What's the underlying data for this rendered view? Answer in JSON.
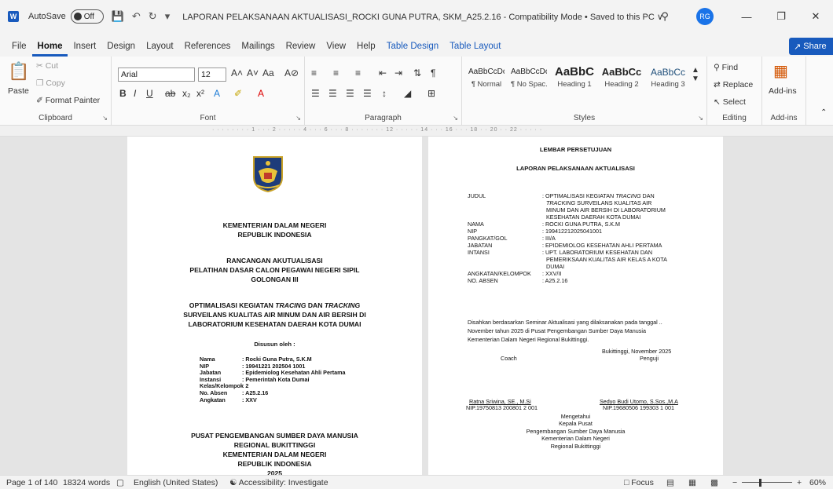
{
  "titlebar": {
    "app_icon": "W",
    "autosave_label": "AutoSave",
    "autosave_state": "Off",
    "document_title": "LAPORAN PELAKSANAAN AKTUALISASI_ROCKI GUNA PUTRA, SKM_A25.2.16  -  Compatibility Mode • Saved to this PC ∨",
    "user_initials": "RG"
  },
  "menu": {
    "items": [
      "File",
      "Home",
      "Insert",
      "Design",
      "Layout",
      "References",
      "Mailings",
      "Review",
      "View",
      "Help",
      "Table Design",
      "Table Layout"
    ],
    "share_label": "Share"
  },
  "ribbon": {
    "clipboard": {
      "paste": "Paste",
      "cut": "Cut",
      "copy": "Copy",
      "format_painter": "Format Painter",
      "label": "Clipboard"
    },
    "font": {
      "font_name": "Arial",
      "font_size": "12",
      "label": "Font"
    },
    "paragraph": {
      "label": "Paragraph"
    },
    "styles": {
      "items": [
        {
          "sample": "AaBbCcDc",
          "name": "¶ Normal"
        },
        {
          "sample": "AaBbCcDc",
          "name": "¶ No Spac..."
        },
        {
          "sample": "AaBbC",
          "name": "Heading 1"
        },
        {
          "sample": "AaBbCc",
          "name": "Heading 2"
        },
        {
          "sample": "AaBbCc",
          "name": "Heading 3"
        }
      ],
      "label": "Styles"
    },
    "editing": {
      "find": "Find",
      "replace": "Replace",
      "select": "Select",
      "label": "Editing"
    },
    "addins": {
      "button": "Add-ins",
      "label": "Add-ins"
    }
  },
  "ruler_text": "· · · · · · · · 1 · · · 2 · · · · · 4 · · · 6 · · · 8 · · · · · · · 12 · · · · · 14 · · · 16 · · · 18 · · 20 · · 22 · · · · ·",
  "page1": {
    "ministry": [
      "KEMENTERIAN DALAM NEGERI",
      "REPUBLIK INDONESIA"
    ],
    "design": [
      "RANCANGAN AKUTUALISASI",
      "PELATIHAN DASAR CALON PEGAWAI NEGERI SIPIL",
      "GOLONGAN III"
    ],
    "topic_parts": [
      "OPTIMALISASI KEGIATAN ",
      "TRACING",
      " DAN ",
      "TRACKING"
    ],
    "topic_rest": [
      "SURVEILANS KUALITAS AIR MINUM DAN AIR BERSIH DI",
      "LABORATORIUM KESEHATAN DAERAH KOTA DUMAI"
    ],
    "prepared_by": "Disusun oleh :",
    "fields": [
      {
        "k": "Nama",
        "v": ": Rocki Guna Putra, S.K.M"
      },
      {
        "k": "NIP",
        "v": ": 19941221 202504 1001"
      },
      {
        "k": "Jabatan",
        "v": ": Epidemiolog Kesehatan Ahli Pertama"
      },
      {
        "k": "Instansi",
        "v": ": Pemerintah Kota Dumai"
      },
      {
        "k": "Kelas/Kelompok",
        "v": ": 2"
      },
      {
        "k": "No. Absen",
        "v": ": A25.2.16"
      },
      {
        "k": "Angkatan",
        "v": ": XXV"
      }
    ],
    "footer": [
      "PUSAT PENGEMBANGAN SUMBER DAYA MANUSIA",
      "REGIONAL BUKITTINGGI",
      "KEMENTERIAN DALAM NEGERI",
      "REPUBLIK INDONESIA",
      "2025"
    ]
  },
  "page2": {
    "heading": "LEMBAR PERSETUJUAN",
    "subheading": "LAPORAN PELAKSANAAN AKTUALISASI",
    "judul_key": "JUDUL",
    "judul_parts": [
      ": OPTIMALISASI KEGIATAN ",
      "TRACING",
      " DAN"
    ],
    "judul_lines": [
      "SURVEILANS KUALITAS AIR",
      "MINUM DAN AIR BERSIH DI LABORATORIUM",
      "KESEHATAN DAERAH KOTA DUMAI"
    ],
    "judul_tracking": "TRACKING",
    "fields": [
      {
        "k": "NAMA",
        "v": ": ROCKI GUNA PUTRA, S.K.M"
      },
      {
        "k": "NIP",
        "v": ": 199412212025041001"
      },
      {
        "k": "PANGKAT/GOL",
        "v": ": III/A"
      },
      {
        "k": "JABATAN",
        "v": ": EPIDEMIOLOG KESEHATAN AHLI PERTAMA"
      },
      {
        "k": "INTANSI",
        "v": ": UPT. LABORATORIUM KESEHATAN DAN"
      },
      {
        "k": "",
        "v": "PEMERIKSAAN KUALITAS AIR KELAS A KOTA"
      },
      {
        "k": "",
        "v": "DUMAI"
      },
      {
        "k": "ANGKATAN/KELOMPOK",
        "v": ": XXV/II"
      },
      {
        "k": "NO. ABSEN",
        "v": ": A25.2.16"
      }
    ],
    "approval": [
      "Disahkan berdasarkan Seminar Aktualisasi yang dilaksanakan pada tanggal ..",
      "November tahun 2025 di Pusat Pengembangan Sumber Daya Manusia",
      "Kementerian Dalam Negeri Regional Bukittinggi."
    ],
    "place_date": "Bukittinggi,   November 2025",
    "coach_label": "Coach",
    "examiner_label": "Penguji",
    "coach_name": "Ratna Sriwina, SE., M.Si",
    "coach_nip": "NIP.19750813 200801 2 001",
    "examiner_name": "Sedyo Budi Utomo, S.Sos.,M.A",
    "examiner_nip": "NIP.19680506 199303 1 001",
    "acknowledge": [
      "Mengetahui",
      "Kepala Pusat",
      "Pengembangan Sumber Daya Manusia",
      "Kementerian Dalam Negeri",
      "Regional Bukittinggi"
    ]
  },
  "status": {
    "page": "Page 1 of 140",
    "words": "18324 words",
    "language": "English (United States)",
    "accessibility": "Accessibility: Investigate",
    "focus": "Focus",
    "zoom": "60%"
  }
}
